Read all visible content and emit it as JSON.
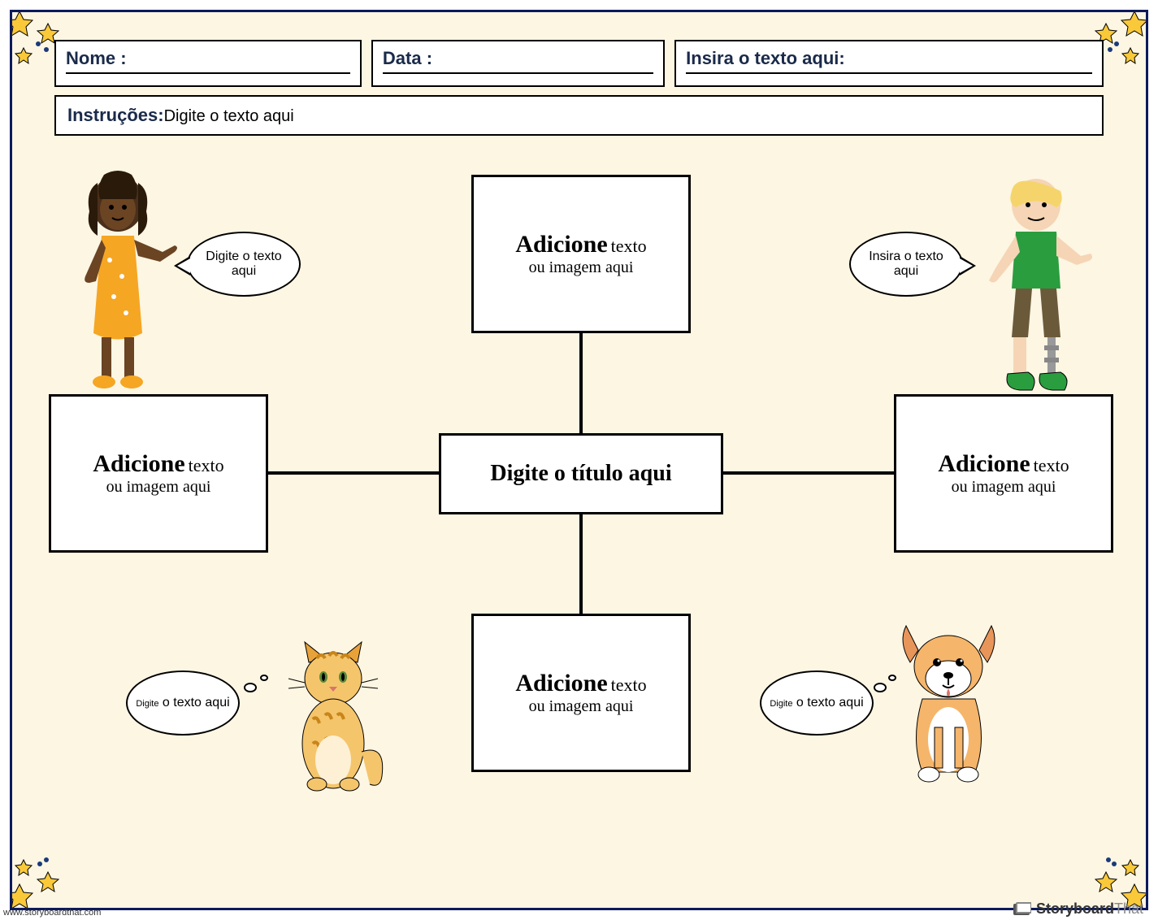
{
  "header": {
    "name_label": "Nome :",
    "date_label": "Data :",
    "extra_label": "Insira o texto aqui:"
  },
  "instructions": {
    "label": "Instruções:",
    "text": "Digite o texto aqui"
  },
  "center": {
    "title": "Digite o título aqui"
  },
  "nodes": {
    "top": {
      "bold": "Adicione",
      "lite": "texto",
      "sub": "ou imagem aqui"
    },
    "left": {
      "bold": "Adicione",
      "lite": "texto",
      "sub": "ou imagem aqui"
    },
    "right": {
      "bold": "Adicione",
      "lite": "texto",
      "sub": "ou imagem aqui"
    },
    "bottom": {
      "bold": "Adicione",
      "lite": "texto",
      "sub": "ou imagem aqui"
    }
  },
  "bubbles": {
    "girl": "Digite o texto aqui",
    "boy": "Insira o texto aqui",
    "cat": {
      "sm": "Digite",
      "rest": "o texto aqui"
    },
    "dog": {
      "sm": "Digite",
      "rest": "o texto aqui"
    }
  },
  "footer": {
    "url": "www.storyboardthat.com",
    "brand": "Storyboard",
    "brand2": "That"
  }
}
